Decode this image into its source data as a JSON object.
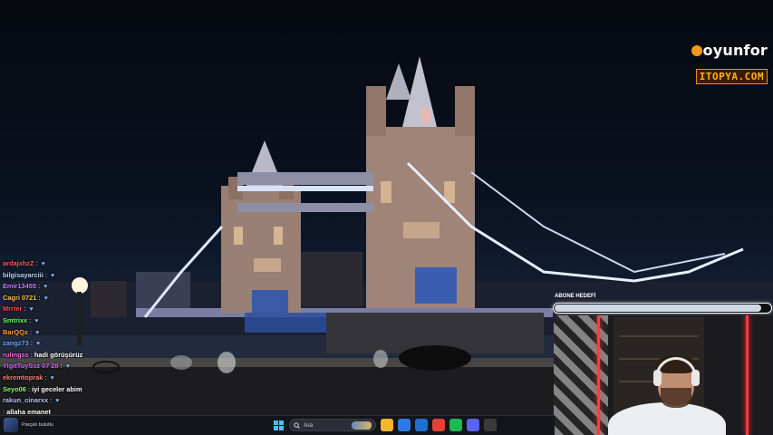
{
  "logos": {
    "primary": "oyunfor",
    "secondary": "ITOPYA.COM"
  },
  "chat": [
    {
      "user": "ardajxhzZ",
      "msg": "",
      "color": "#ff5a5a"
    },
    {
      "user": "bilgisayarciii",
      "msg": "",
      "color": "#b8d7ff"
    },
    {
      "user": "Emir13455",
      "msg": "",
      "color": "#c084fc"
    },
    {
      "user": "Cagri 0721",
      "msg": "",
      "color": "#f5c542"
    },
    {
      "user": "Mrrter",
      "msg": "",
      "color": "#ff4d4d"
    },
    {
      "user": "Smtrixx",
      "msg": "",
      "color": "#6bff6b"
    },
    {
      "user": "BarQQx",
      "msg": "",
      "color": "#ff9f43"
    },
    {
      "user": "zangz73",
      "msg": "",
      "color": "#6fa8ff"
    },
    {
      "user": "rulingss",
      "msg": "hadi görüşürüz",
      "color": "#ff6ad5"
    },
    {
      "user": "YigitTuySsz 07 28",
      "msg": "",
      "color": "#d06bff"
    },
    {
      "user": "ekremtoprak",
      "msg": "",
      "color": "#ff7b7b"
    },
    {
      "user": "Seyo06",
      "msg": "iyi geceler abim",
      "color": "#8cff6b"
    },
    {
      "user": "rakun_cinarxx",
      "msg": "",
      "color": "#b8c4ff"
    },
    {
      "user": "",
      "msg": "allaha emanet",
      "color": "#ffffff"
    }
  ],
  "goal": {
    "label": "ABONE HEDEFİ",
    "progress": 0.96
  },
  "taskbar": {
    "now_playing_caption": "Parçalı bulutlu",
    "search_placeholder": "Ara",
    "pinned_apps": [
      {
        "icon": "file-explorer-icon",
        "color": "#f3b72e"
      },
      {
        "icon": "store-icon",
        "color": "#2c7be5"
      },
      {
        "icon": "mail-icon",
        "color": "#1f6fd1"
      },
      {
        "icon": "chrome-icon",
        "color": "#e44134"
      },
      {
        "icon": "spotify-icon",
        "color": "#1db954"
      },
      {
        "icon": "discord-icon",
        "color": "#5865f2"
      },
      {
        "icon": "obs-icon",
        "color": "#3a3a3a"
      }
    ]
  },
  "colors": {
    "accent": "#f39a1e",
    "goal_border": "#ffffff",
    "webcam_led": "#ff3b3b"
  }
}
